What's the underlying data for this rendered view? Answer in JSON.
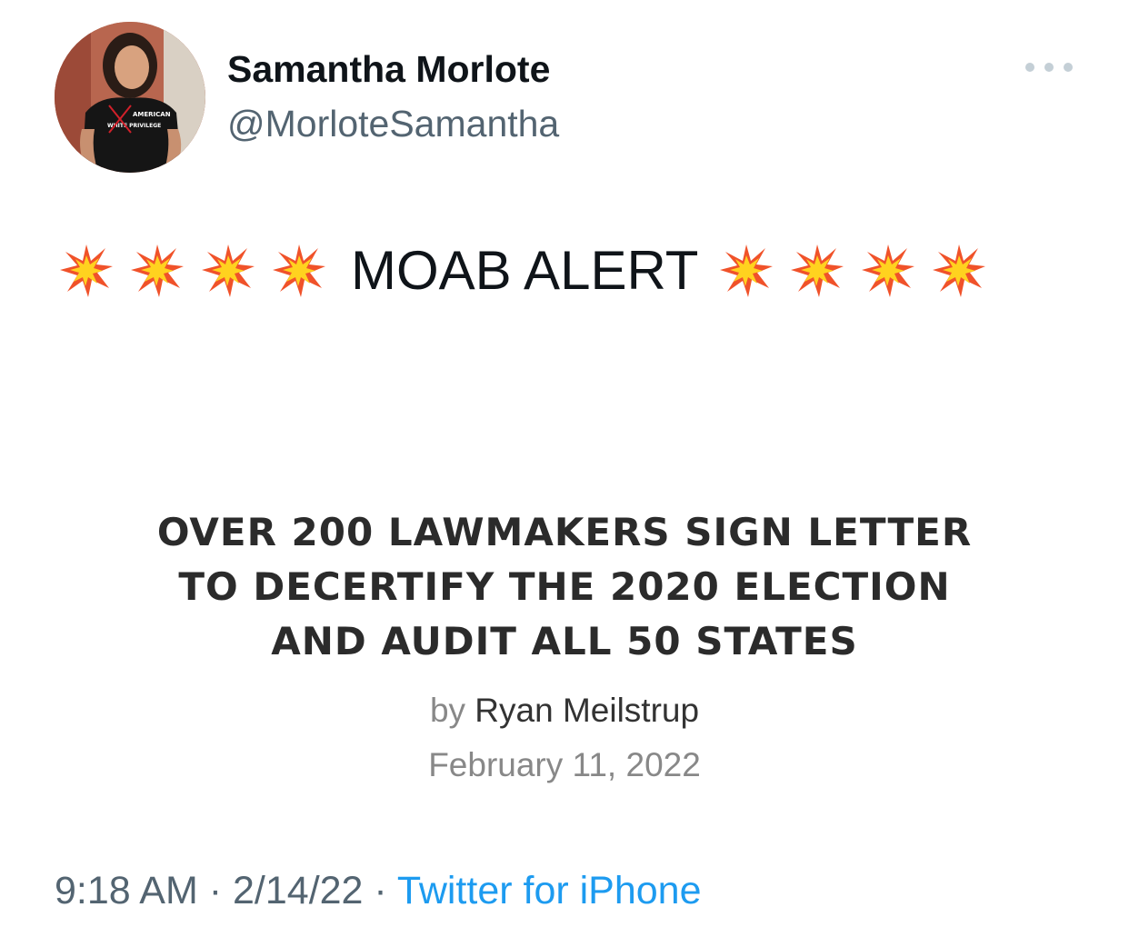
{
  "author": {
    "display_name": "Samantha Morlote",
    "handle": "@MorloteSamantha",
    "avatar_shirt_text_line1": "AMERICAN",
    "avatar_shirt_text_line2": "WHITE PRIVILEGE"
  },
  "more_menu_icon": "more-dots-icon",
  "tweet": {
    "text": "MOAB ALERT",
    "emoji_left": [
      "collision-emoji",
      "collision-emoji",
      "collision-emoji",
      "collision-emoji"
    ],
    "emoji_right": [
      "collision-emoji",
      "collision-emoji",
      "collision-emoji",
      "collision-emoji"
    ]
  },
  "article": {
    "headline_lines": [
      "OVER 200 LAWMAKERS SIGN LETTER",
      "TO DECERTIFY THE 2020 ELECTION",
      "AND AUDIT ALL 50 STATES"
    ],
    "by_label": "by",
    "author": "Ryan Meilstrup",
    "date": "February 11, 2022"
  },
  "meta": {
    "time": "9:18 AM",
    "separator": "·",
    "date": "2/14/22",
    "source": "Twitter for iPhone"
  },
  "colors": {
    "text_primary": "#0f1419",
    "text_secondary": "#536471",
    "link": "#1d9bf0",
    "headline": "#2b2b2b"
  }
}
